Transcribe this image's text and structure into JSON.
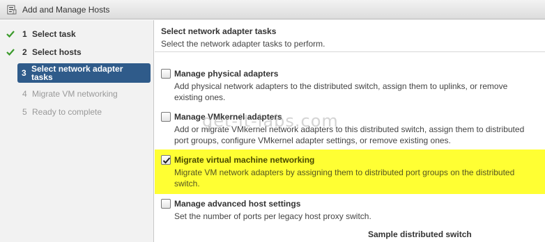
{
  "window": {
    "title": "Add and Manage Hosts",
    "icon": "wizard-icon"
  },
  "steps": [
    {
      "num": "1",
      "label": "Select task",
      "state": "done"
    },
    {
      "num": "2",
      "label": "Select hosts",
      "state": "done"
    },
    {
      "num": "3",
      "label": "Select network adapter tasks",
      "state": "active"
    },
    {
      "num": "4",
      "label": "Migrate VM networking",
      "state": "pending"
    },
    {
      "num": "5",
      "label": "Ready to complete",
      "state": "pending"
    }
  ],
  "main": {
    "title": "Select network adapter tasks",
    "subtitle": "Select the network adapter tasks to perform.",
    "options": [
      {
        "label": "Manage physical adapters",
        "checked": false,
        "highlighted": false,
        "desc_line1": "Add physical network adapters to the distributed switch, assign them to uplinks, or remove",
        "desc_line2": "existing ones."
      },
      {
        "label": "Manage VMkernel adapters",
        "checked": false,
        "highlighted": false,
        "desc_line1": "Add or migrate VMkernel network adapters to this distributed switch, assign them to distributed",
        "desc_line2": "port groups, configure VMkernel adapter settings, or remove existing ones."
      },
      {
        "label": "Migrate virtual machine networking",
        "checked": true,
        "highlighted": true,
        "desc_line1": "Migrate VM network adapters by assigning them to distributed port groups on the distributed",
        "desc_line2": "switch."
      },
      {
        "label": "Manage advanced host settings",
        "checked": false,
        "highlighted": false,
        "desc_line1": "Set the number of ports per legacy host proxy switch.",
        "desc_line2": ""
      }
    ],
    "footer_label": "Sample distributed switch"
  },
  "watermark": "get-it-labs.com",
  "colors": {
    "active_step": "#2f5b8a",
    "check_green": "#3a9a2a",
    "highlight": "#ffff33"
  }
}
